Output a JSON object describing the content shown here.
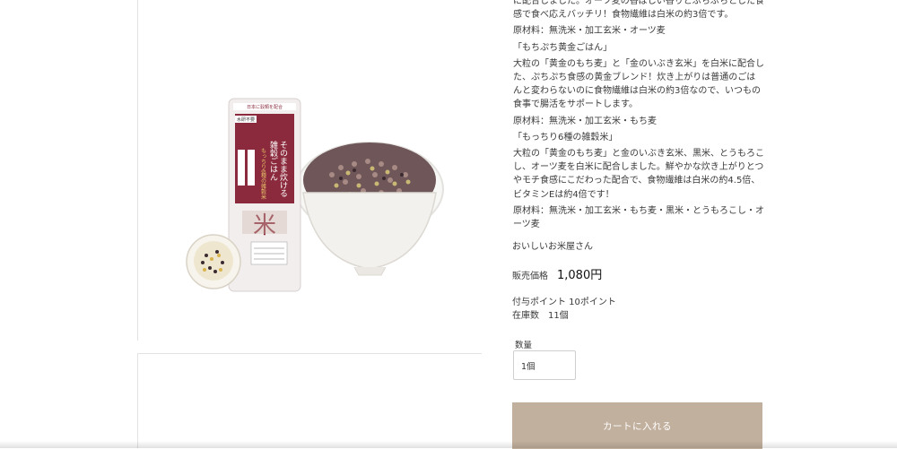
{
  "description": {
    "lines": [
      "に配合しました。オーツ麦の香ばしい香りとぷちぷちとした食感で食べ応えバッチリ！食物繊維は白米の約3倍です。",
      "原材料：無洗米・加工玄米・オーツ麦",
      "「もちぷち黄金ごはん」",
      "大粒の「黄金のもち麦」と「金のいぶき玄米」を白米に配合した、ぷちぷち食感の黄金ブレンド！炊き上がりは普通のごはんと変わらないのに食物繊維は白米の約3倍なので、いつもの食事で腸活をサポートします。",
      "原材料：無洗米・加工玄米・もち麦",
      "「もっちり6種の雑穀米」",
      "大粒の「黄金のもち麦」と金のいぶき玄米、黒米、とうもろこし、オーツ麦を白米に配合しました。鮮やかな炊き上がりとつやモチ食感にこだわった配合で、食物繊維は白米の約4.5倍、ビタミンEは約4倍です！",
      "原材料：無洗米・加工玄米・もち麦・黒米・とうもろこし・オーツ麦"
    ]
  },
  "shop": {
    "name": "おいしいお米屋さん"
  },
  "price": {
    "label": "販売価格",
    "value": "1,080円"
  },
  "points": {
    "text": "付与ポイント 10ポイント"
  },
  "stock": {
    "text": "在庫数　11個"
  },
  "quantity": {
    "label": "数量",
    "value": "1個"
  },
  "cart": {
    "button_label": "カートに入れる"
  },
  "package": {
    "title": "そのまま炊ける雑穀ごはん",
    "subtitle": "もっちり6種の雑穀米",
    "top_label": "日本に穀類を配合",
    "badge": "水研不要",
    "big_char": "米"
  },
  "colors": {
    "cart_button": "#c2b09e",
    "package": "#8a2a3c"
  }
}
